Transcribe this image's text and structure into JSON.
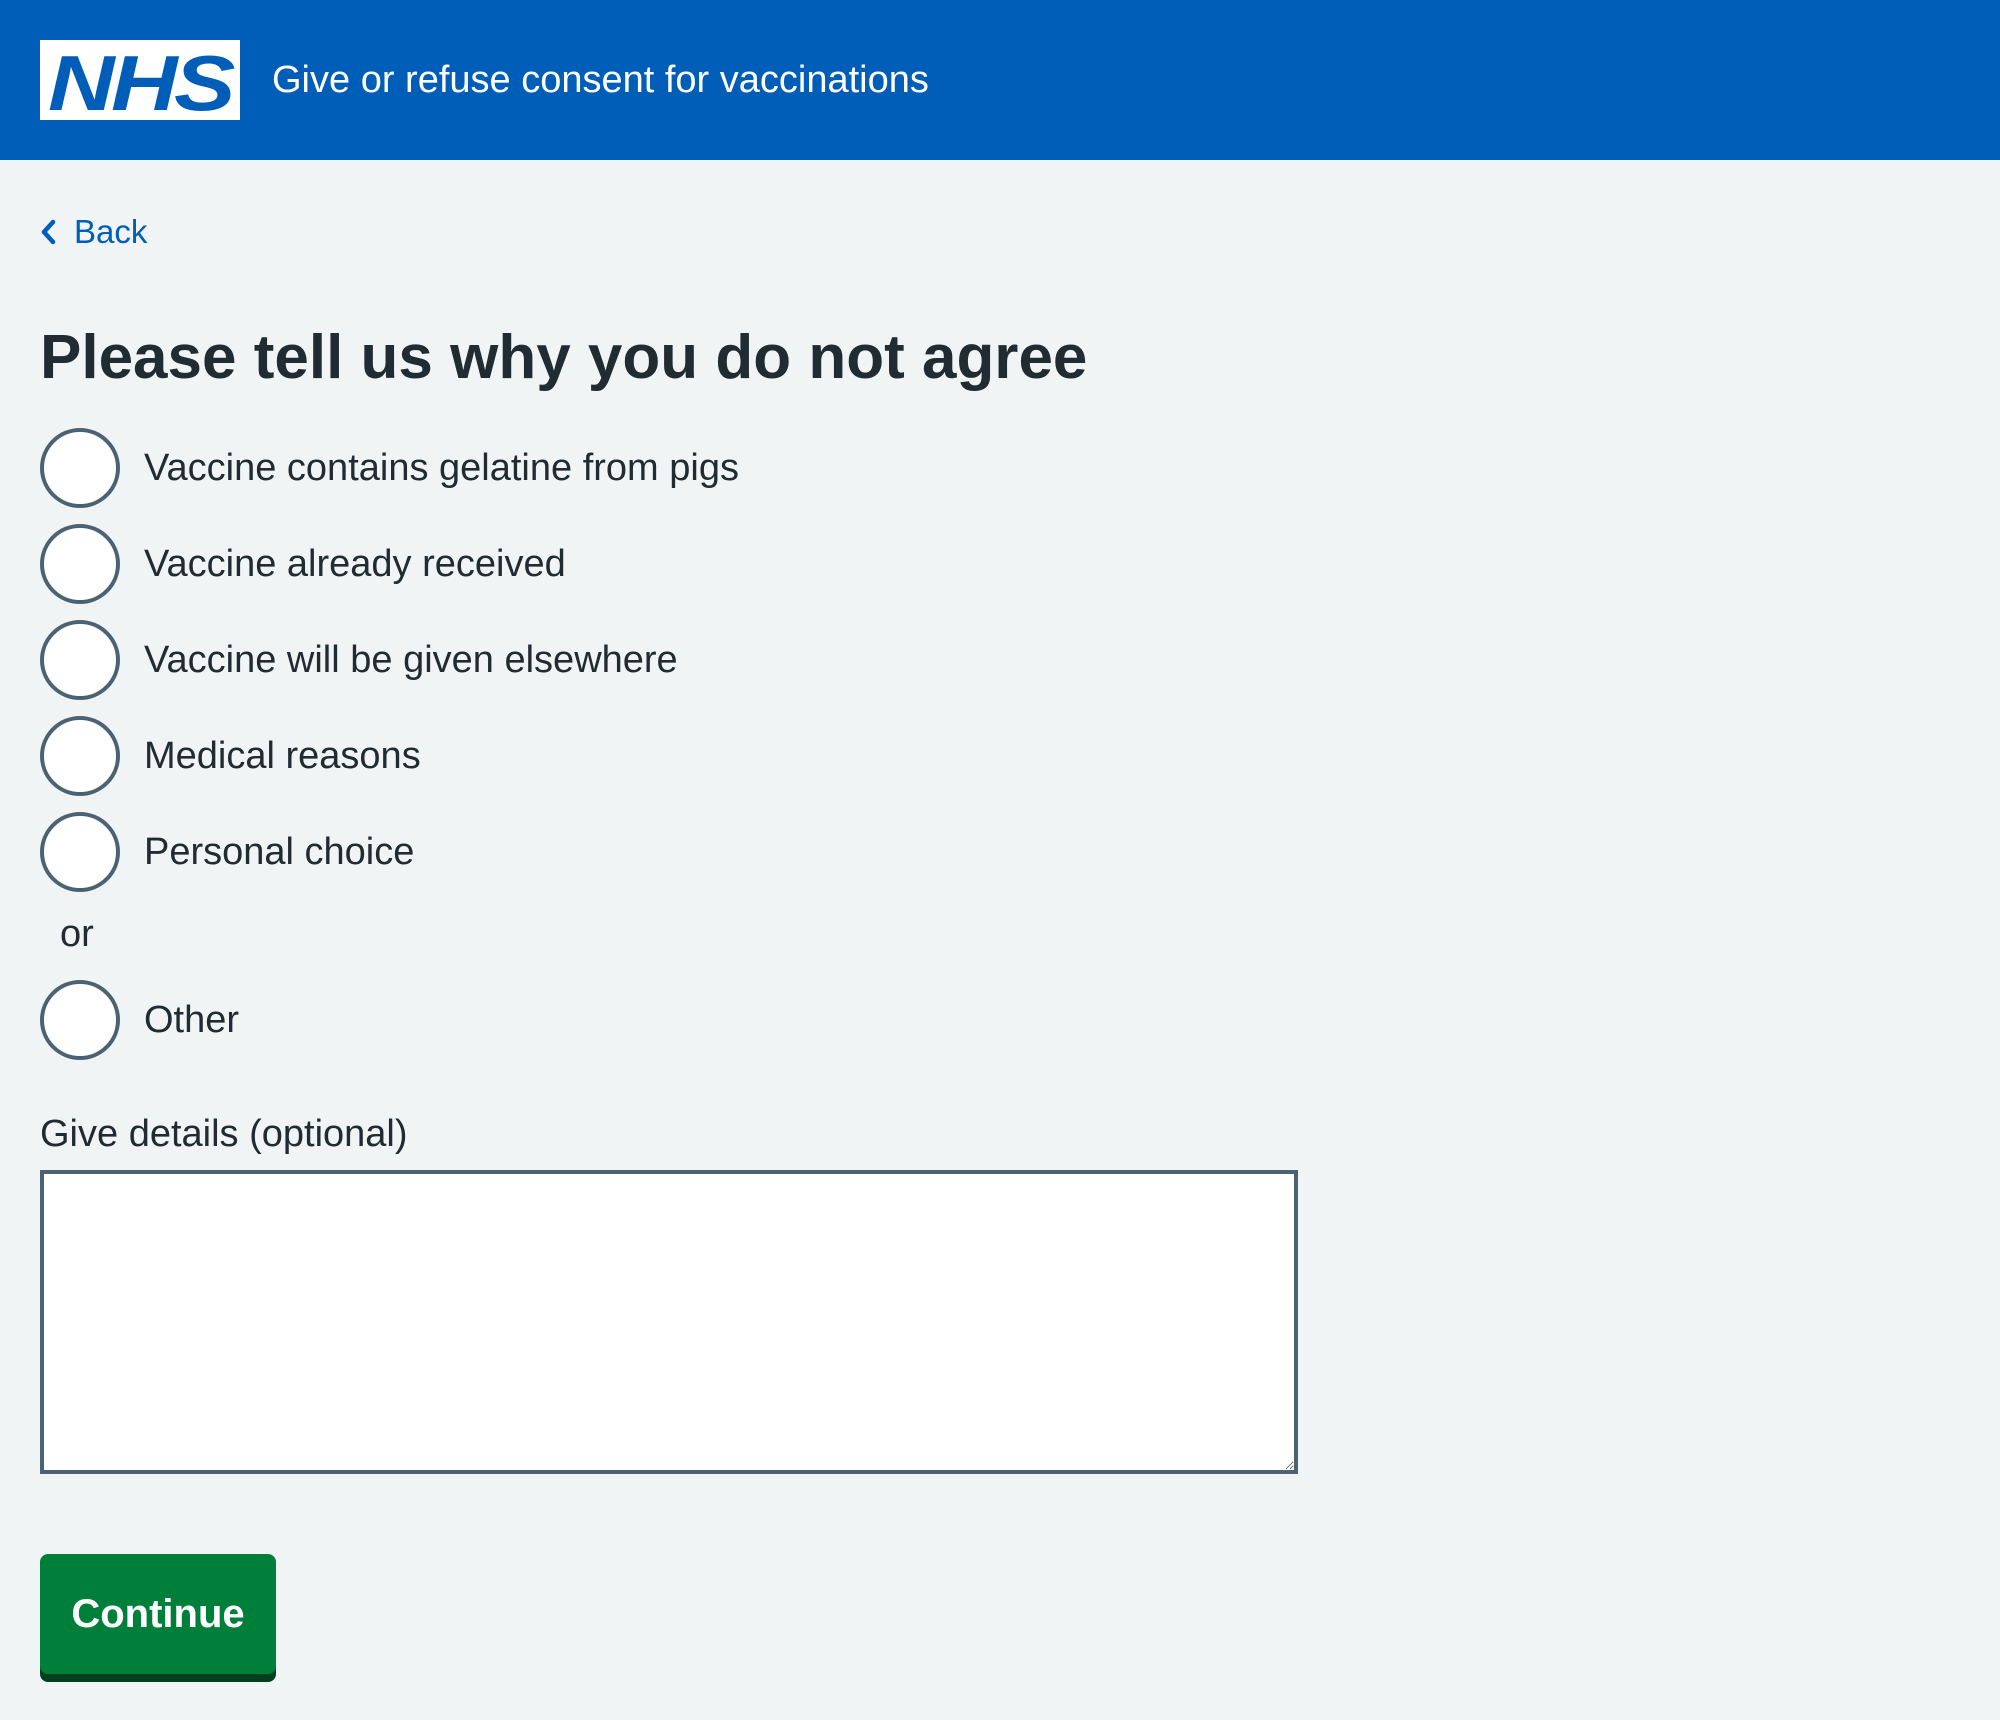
{
  "header": {
    "logo_text": "NHS",
    "service_name": "Give or refuse consent for vaccinations",
    "brand_color": "#005eb8"
  },
  "back_link": {
    "label": "Back",
    "icon": "chevron-left-icon"
  },
  "page_title": "Please tell us why you do not agree",
  "radio_options": [
    {
      "label": "Vaccine contains gelatine from pigs",
      "selected": false
    },
    {
      "label": "Vaccine already received",
      "selected": false
    },
    {
      "label": "Vaccine will be given elsewhere",
      "selected": false
    },
    {
      "label": "Medical reasons",
      "selected": false
    },
    {
      "label": "Personal choice",
      "selected": false
    }
  ],
  "divider_text": "or",
  "other_option": {
    "label": "Other",
    "selected": false
  },
  "details": {
    "label": "Give details (optional)",
    "value": ""
  },
  "continue_button": {
    "label": "Continue",
    "color": "#007f3b"
  },
  "colors": {
    "page_background": "#f0f4f5",
    "text": "#212b32",
    "link": "#005eb8",
    "input_border": "#4c6272"
  }
}
